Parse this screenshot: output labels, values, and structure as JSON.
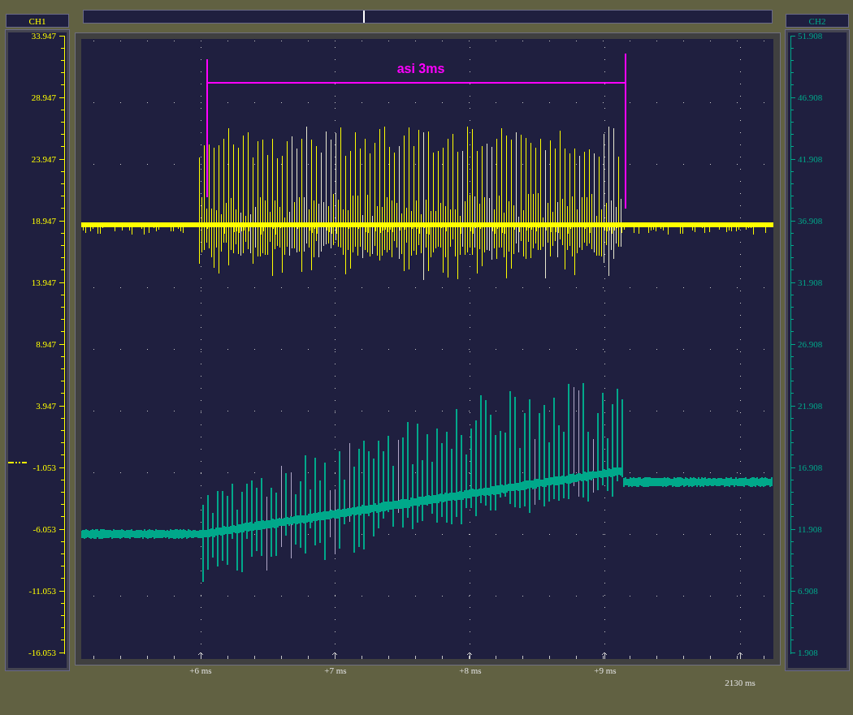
{
  "channels": [
    {
      "name": "CH1",
      "color": "#ffff00",
      "labels": [
        "33.947",
        "28.947",
        "23.947",
        "18.947",
        "13.947",
        "8.947",
        "3.947",
        "-1.053",
        "-6.053",
        "-11.053",
        "-16.053"
      ]
    },
    {
      "name": "CH2",
      "color": "#00a88a",
      "labels": [
        "51.908",
        "46.908",
        "41.908",
        "36.908",
        "31.908",
        "26.908",
        "21.908",
        "16.908",
        "11.908",
        "6.908",
        "1.908"
      ]
    }
  ],
  "annotation": {
    "label": "asi 3ms",
    "color": "#ff00ff"
  },
  "time_ticks": [
    "+6 ms",
    "+7 ms",
    "+8 ms",
    "+9 ms"
  ],
  "cursor_time": "2130 ms"
}
